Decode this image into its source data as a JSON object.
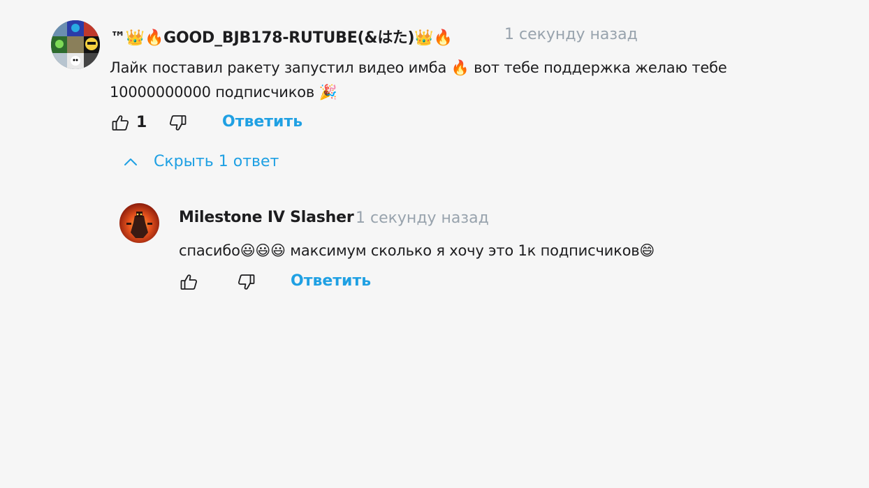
{
  "comment": {
    "author": "™👑🔥GOOD_BJB178-RUTUBE(&はた)👑🔥",
    "time": "1 секунду назад",
    "text_line1": "Лайк поставил ракету запустил видео имба 🔥 вот тебе поддержка  желаю тебе",
    "text_line2": "10000000000 подписчиков 🎉",
    "likes": "1",
    "reply_label": "Ответить"
  },
  "replies_toggle": {
    "label": "Скрыть 1 ответ"
  },
  "reply": {
    "author": "Milestone IV Slasher",
    "time": "1 секунду назад",
    "text": "спасибо😃😃😃 максимум сколько я хочу это 1к подписчиков😄",
    "reply_label": "Ответить"
  },
  "colors": {
    "background": "#f6f6f6",
    "link": "#1fa0e3",
    "timestamp": "#98a3ad"
  },
  "icons": [
    "thumbs-up-icon",
    "thumbs-down-icon",
    "chevron-up-icon"
  ]
}
